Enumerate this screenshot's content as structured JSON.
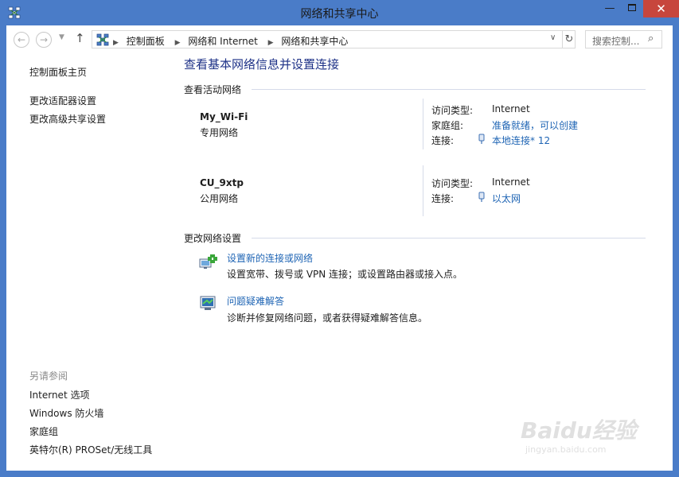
{
  "window": {
    "title": "网络和共享中心",
    "minimize_glyph": "—",
    "close_glyph": "✕"
  },
  "address_bar": {
    "back_glyph": "←",
    "forward_glyph": "→",
    "dropdown_glyph": "▼",
    "up_glyph": "↑",
    "breadcrumbs": [
      "控制面板",
      "网络和 Internet",
      "网络和共享中心"
    ],
    "breadcrumb_separator": "▶",
    "address_dropdown_glyph": "∨",
    "refresh_glyph": "↻",
    "search_placeholder": "搜索控制...",
    "search_glyph": "⌕"
  },
  "left_nav": {
    "home": "控制面板主页",
    "adapter_settings": "更改适配器设置",
    "sharing_settings": "更改高级共享设置",
    "see_also_title": "另请参阅",
    "see_also": [
      "Internet 选项",
      "Windows 防火墙",
      "家庭组",
      "英特尔(R) PROSet/无线工具"
    ]
  },
  "main": {
    "heading": "查看基本网络信息并设置连接",
    "active_networks_title": "查看活动网络",
    "networks": [
      {
        "name": "My_Wi-Fi",
        "type": "专用网络",
        "access_label": "访问类型:",
        "access_value": "Internet",
        "homegroup_label": "家庭组:",
        "homegroup_value": "准备就绪，可以创建",
        "connection_label": "连接:",
        "connection_value": "本地连接* 12"
      },
      {
        "name": "CU_9xtp",
        "type": "公用网络",
        "access_label": "访问类型:",
        "access_value": "Internet",
        "connection_label": "连接:",
        "connection_value": "以太网"
      }
    ],
    "change_settings_title": "更改网络设置",
    "tasks": [
      {
        "icon": "new-connection-icon",
        "link": "设置新的连接或网络",
        "description": "设置宽带、拨号或 VPN 连接；或设置路由器或接入点。"
      },
      {
        "icon": "troubleshoot-icon",
        "link": "问题疑难解答",
        "description": "诊断并修复网络问题，或者获得疑难解答信息。"
      }
    ]
  },
  "watermark": {
    "brand": "Baidu经验",
    "url": "jingyan.baidu.com"
  },
  "colors": {
    "title_bar": "#4a7cc8",
    "close_button": "#c7463d",
    "heading": "#1e3287",
    "link": "#1e64b4"
  }
}
